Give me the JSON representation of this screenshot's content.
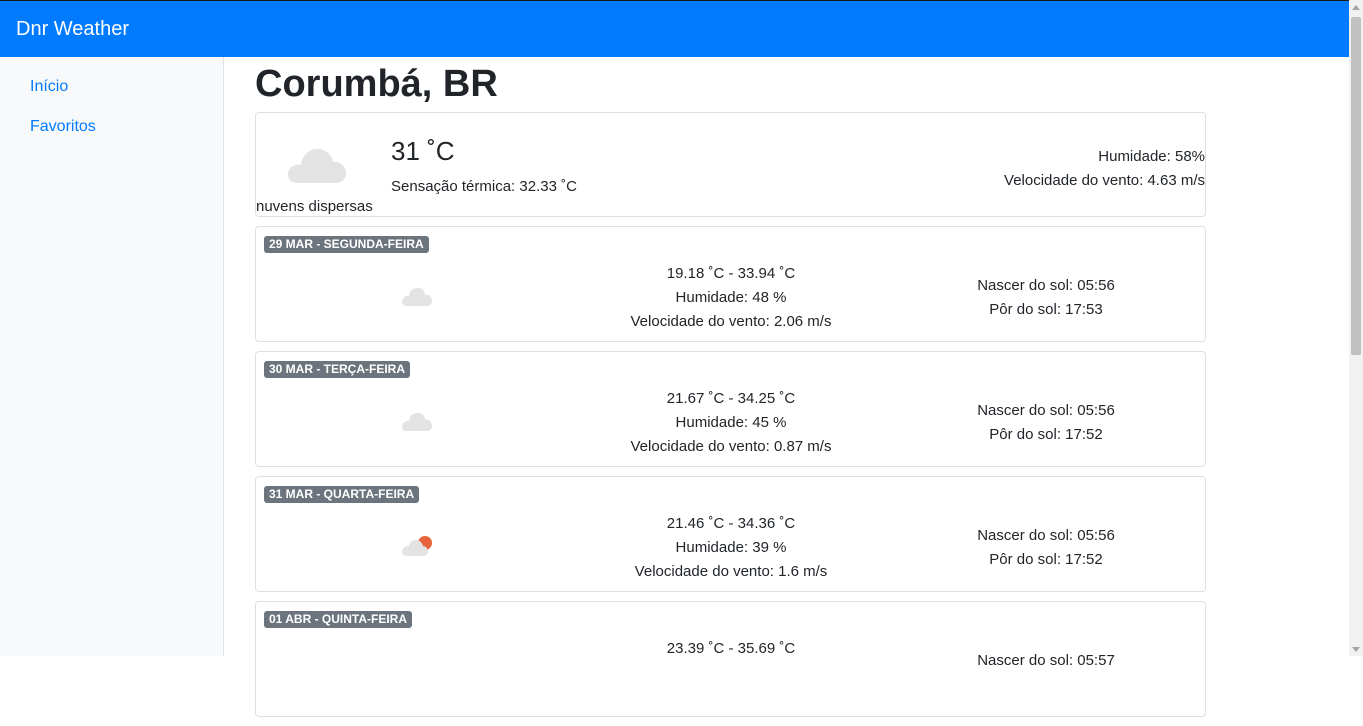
{
  "app": {
    "brand": "Dnr Weather"
  },
  "sidebar": {
    "items": [
      {
        "label": "Início"
      },
      {
        "label": "Favoritos"
      }
    ]
  },
  "city": {
    "name": "Corumbá, BR"
  },
  "current": {
    "icon": "cloud-icon",
    "description": "nuvens dispersas",
    "temperature": "31 ˚C",
    "feels_like": "Sensação térmica: 32.33 ˚C",
    "humidity": "Humidade: 58%",
    "wind": "Velocidade do vento: 4.63 m/s"
  },
  "forecast": [
    {
      "date": "29 MAR - SEGUNDA-FEIRA",
      "icon": "cloud-icon",
      "temp_range": "19.18 ˚C - 33.94 ˚C",
      "humidity": "Humidade: 48 %",
      "wind": "Velocidade do vento: 2.06 m/s",
      "sunrise": "Nascer do sol: 05:56",
      "sunset": "Pôr do sol: 17:53"
    },
    {
      "date": "30 MAR - TERÇA-FEIRA",
      "icon": "cloud-icon",
      "temp_range": "21.67 ˚C - 34.25 ˚C",
      "humidity": "Humidade: 45 %",
      "wind": "Velocidade do vento: 0.87 m/s",
      "sunrise": "Nascer do sol: 05:56",
      "sunset": "Pôr do sol: 17:52"
    },
    {
      "date": "31 MAR - QUARTA-FEIRA",
      "icon": "partly-cloudy-icon",
      "temp_range": "21.46 ˚C - 34.36 ˚C",
      "humidity": "Humidade: 39 %",
      "wind": "Velocidade do vento: 1.6 m/s",
      "sunrise": "Nascer do sol: 05:56",
      "sunset": "Pôr do sol: 17:52"
    },
    {
      "date": "01 ABR - QUINTA-FEIRA",
      "icon": "cloud-icon",
      "temp_range": "23.39 ˚C - 35.69 ˚C",
      "humidity": "",
      "wind": "",
      "sunrise": "Nascer do sol: 05:57",
      "sunset": ""
    }
  ],
  "colors": {
    "navbar": "#007bff",
    "link": "#007bff",
    "badge": "#6c757d",
    "cloud": "#e3e3e3",
    "sun": "#e8643c"
  }
}
